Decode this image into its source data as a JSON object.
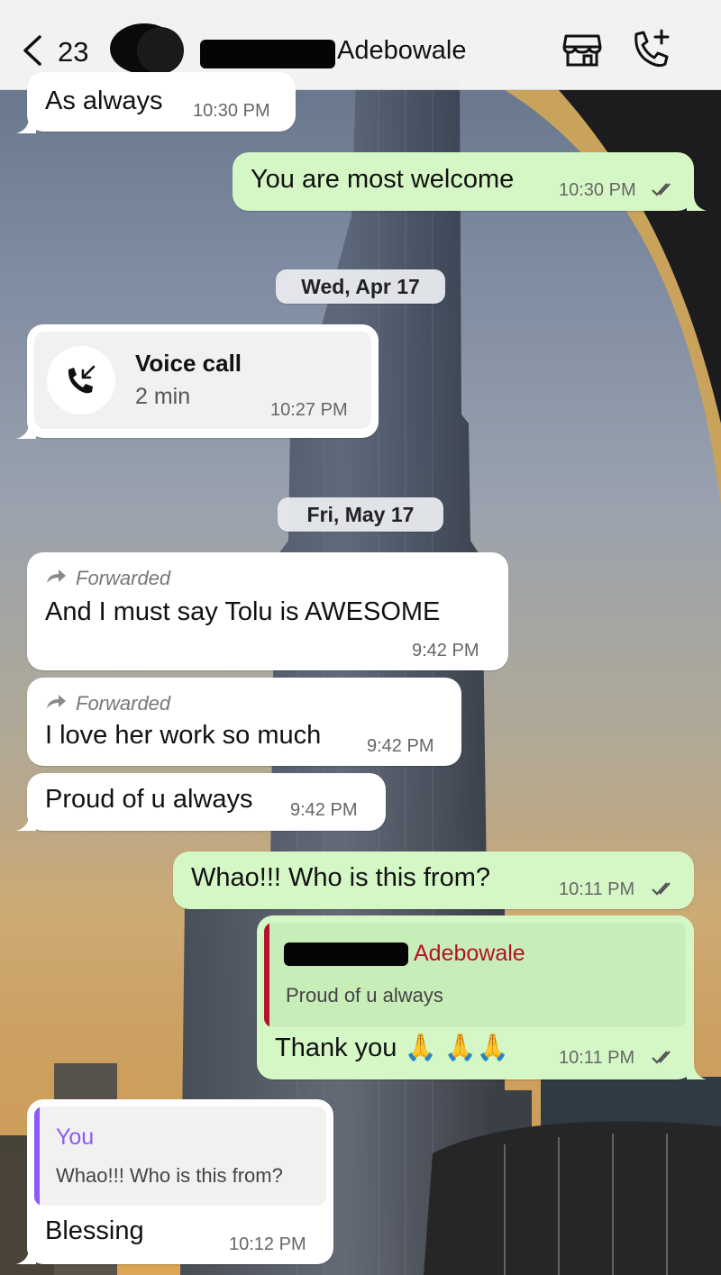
{
  "header": {
    "back_count": "23",
    "contact_name": "Adebowale"
  },
  "messages": [
    {
      "id": "m1",
      "text": "As always",
      "time": "10:30 PM"
    },
    {
      "id": "m2",
      "text": "You are most welcome",
      "time": "10:30 PM"
    },
    {
      "id": "d1",
      "date": "Wed, Apr 17"
    },
    {
      "id": "m3",
      "title": "Voice call",
      "duration": "2 min",
      "time": "10:27 PM"
    },
    {
      "id": "d2",
      "date": "Fri, May 17"
    },
    {
      "id": "m4",
      "forwarded": "Forwarded",
      "text": "And I must say Tolu is AWESOME",
      "time": "9:42 PM"
    },
    {
      "id": "m5",
      "forwarded": "Forwarded",
      "text": "I love her work so much",
      "time": "9:42 PM"
    },
    {
      "id": "m6",
      "text": "Proud of u always",
      "time": "9:42 PM"
    },
    {
      "id": "m7",
      "text": "Whao!!! Who is this from?",
      "time": "10:11 PM"
    },
    {
      "id": "m8",
      "quote_author": "Adebowale",
      "quote_text": "Proud of u always",
      "text": "Thank you 🙏 🙏🙏",
      "time": "10:11 PM"
    },
    {
      "id": "m9",
      "quote_author": "You",
      "quote_text": "Whao!!! Who is this from?",
      "text": "Blessing",
      "time": "10:12 PM"
    }
  ],
  "colors": {
    "outgoing": "#d5f7c6",
    "incoming": "#ffffff",
    "quote_contact": "#b3132b",
    "quote_you": "#8a5cf5",
    "read_ticks": "#555555"
  },
  "icons": [
    "chevron-left-icon",
    "store-icon",
    "phone-add-icon",
    "incoming-call-icon",
    "forward-arrow-icon",
    "double-tick-icon"
  ]
}
